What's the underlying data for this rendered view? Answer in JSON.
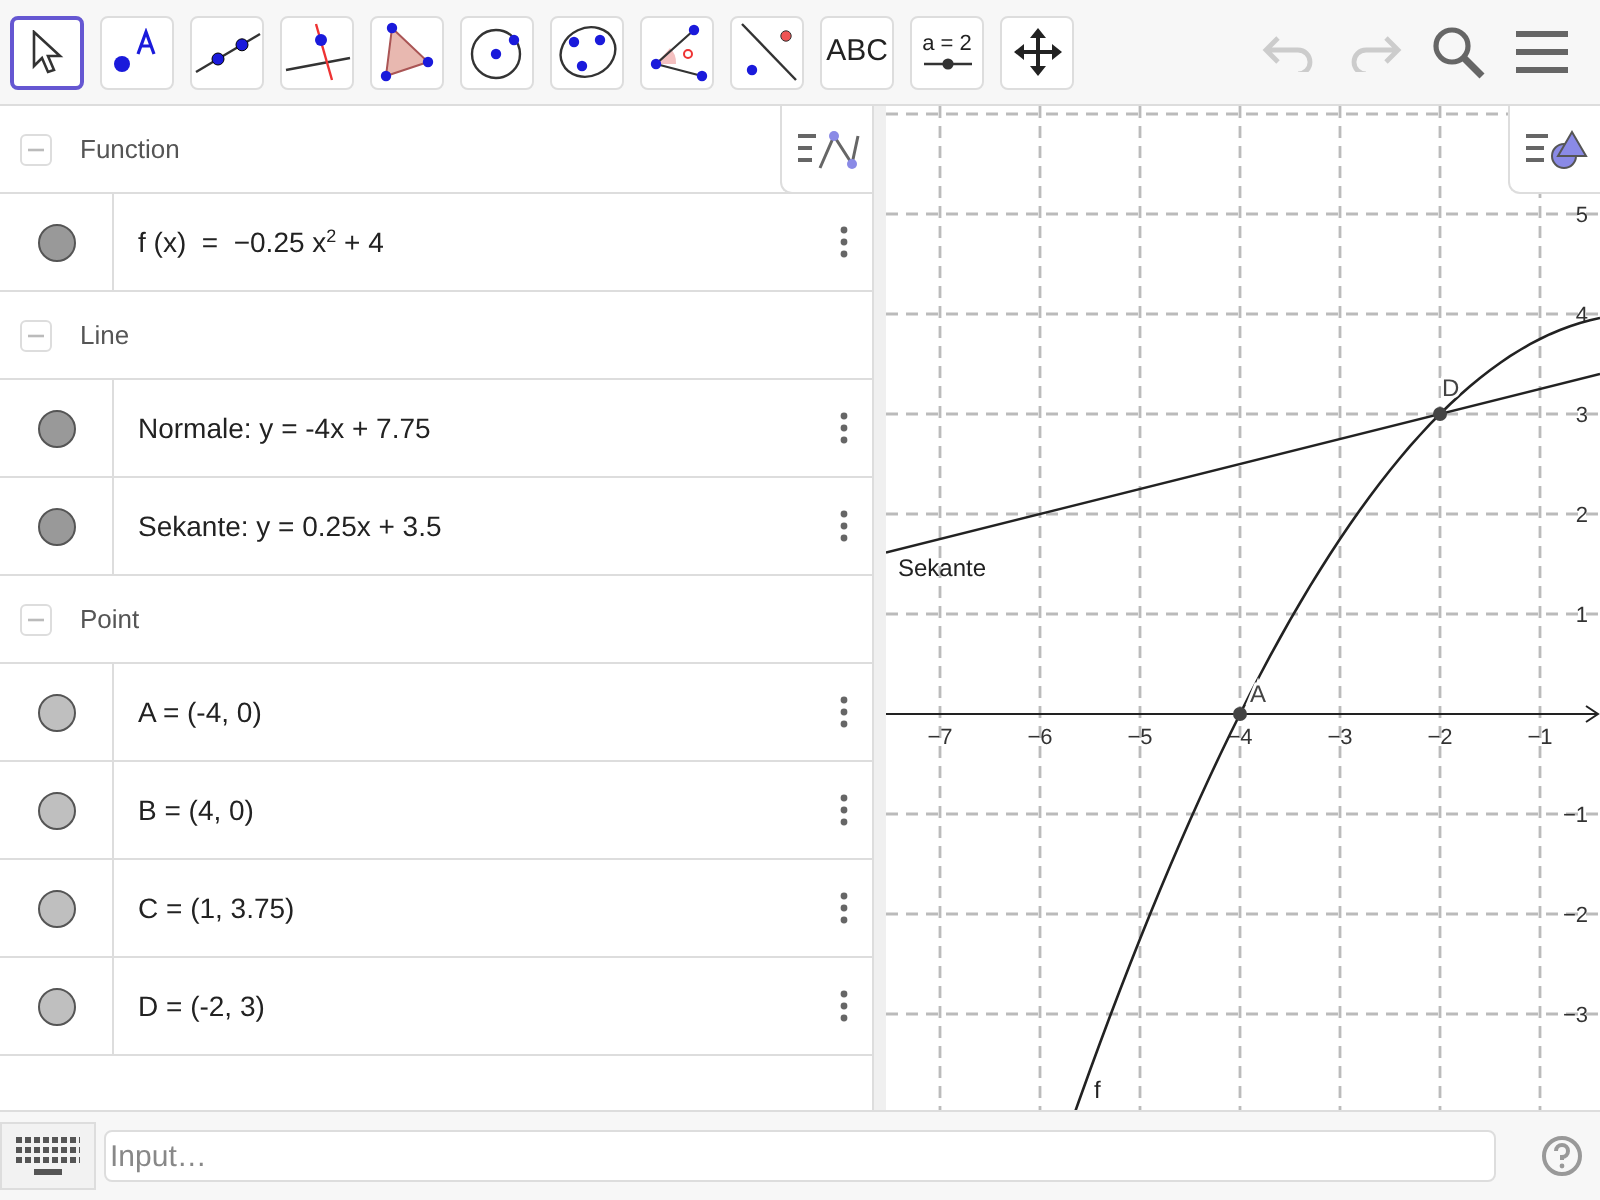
{
  "toolbar": {
    "tools": [
      {
        "kind": "move",
        "selected": true
      },
      {
        "kind": "point",
        "selected": false
      },
      {
        "kind": "line",
        "selected": false
      },
      {
        "kind": "perpendicular",
        "selected": false
      },
      {
        "kind": "polygon",
        "selected": false
      },
      {
        "kind": "circle",
        "selected": false
      },
      {
        "kind": "conic",
        "selected": false
      },
      {
        "kind": "angle",
        "selected": false
      },
      {
        "kind": "reflect",
        "selected": false
      },
      {
        "kind": "text",
        "label": "ABC",
        "selected": false
      },
      {
        "kind": "slider",
        "label": "a = 2",
        "selected": false
      },
      {
        "kind": "pan",
        "selected": false
      }
    ]
  },
  "algebra": {
    "categories": [
      {
        "title": "Function",
        "expanded": true,
        "items": [
          {
            "parts": [
              {
                "t": "f (x)  =  −0.25 x"
              },
              {
                "sup": "2"
              },
              {
                "t": " + 4"
              }
            ],
            "color": "#999999"
          }
        ]
      },
      {
        "title": "Line",
        "expanded": true,
        "items": [
          {
            "parts": [
              {
                "t": "Normale: y = -4x + 7.75"
              }
            ],
            "color": "#999999"
          },
          {
            "parts": [
              {
                "t": "Sekante: y = 0.25x + 3.5"
              }
            ],
            "color": "#999999"
          }
        ]
      },
      {
        "title": "Point",
        "expanded": true,
        "items": [
          {
            "parts": [
              {
                "t": "A = (-4, 0)"
              }
            ],
            "color": "#bfbfbf"
          },
          {
            "parts": [
              {
                "t": "B = (4, 0)"
              }
            ],
            "color": "#bfbfbf"
          },
          {
            "parts": [
              {
                "t": "C = (1, 3.75)"
              }
            ],
            "color": "#bfbfbf"
          },
          {
            "parts": [
              {
                "t": "D = (-2, 3)"
              }
            ],
            "color": "#bfbfbf"
          }
        ]
      }
    ]
  },
  "graphics": {
    "x_ticks": [
      "−7",
      "−6",
      "−5",
      "−4",
      "−3",
      "−2",
      "−1"
    ],
    "y_ticks": [
      "5",
      "4",
      "3",
      "2",
      "1",
      "−1",
      "−2",
      "−3"
    ],
    "labels": {
      "sekante": "Sekante",
      "point_a": "A",
      "point_d": "D",
      "curve": "f"
    }
  },
  "input_bar": {
    "placeholder": "Input…"
  }
}
